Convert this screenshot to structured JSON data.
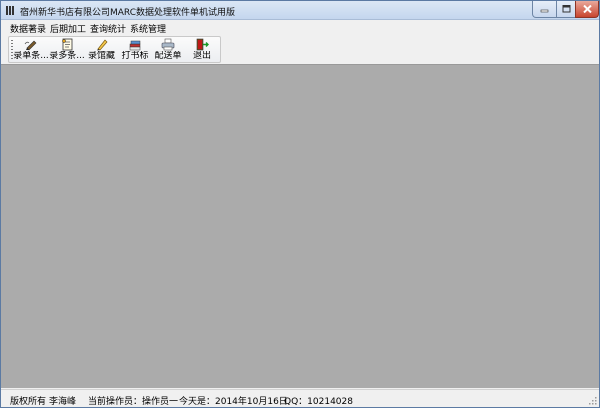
{
  "window": {
    "title": "宿州新华书店有限公司MARC数据处理软件单机试用版"
  },
  "colors": {
    "client_background": "#ababab",
    "titlebar": "#c4d6ee",
    "close_button": "#c8442e"
  },
  "menubar": {
    "items": [
      {
        "label": "数据著录"
      },
      {
        "label": "后期加工"
      },
      {
        "label": "查询统计"
      },
      {
        "label": "系统管理"
      }
    ]
  },
  "toolbar": {
    "buttons": [
      {
        "label": "录单条...",
        "icon": "pen-icon"
      },
      {
        "label": "录多条...",
        "icon": "document-icon"
      },
      {
        "label": "录馆藏",
        "icon": "pencil-icon"
      },
      {
        "label": "打书标",
        "icon": "books-icon"
      },
      {
        "label": "配送单",
        "icon": "printer-icon"
      },
      {
        "label": "退出",
        "icon": "exit-door-icon"
      }
    ]
  },
  "statusbar": {
    "copyright": "版权所有",
    "owner": "李海峰",
    "operator": "当前操作员：操作员一",
    "today": "今天是：2014年10月16日",
    "qq": "QQ：10214028"
  }
}
